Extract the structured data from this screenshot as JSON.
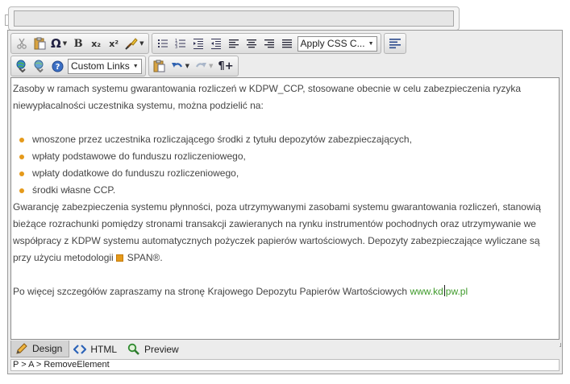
{
  "title_input": {
    "value": ""
  },
  "toolbar": {
    "apply_css_label": "Apply CSS C...",
    "custom_links_label": "Custom Links",
    "bold_label": "B",
    "subscript_label": "x₂",
    "superscript_label": "x²",
    "symbol_label": "Ω",
    "paragraph_label": "¶+"
  },
  "content": {
    "intro": "Zasoby w ramach systemu gwarantowania rozliczeń w KDPW_CCP, stosowane obecnie w celu zabezpieczenia ryzyka niewypłacalności uczestnika systemu, można podzielić na:",
    "items": [
      "wnoszone przez uczestnika rozliczającego środki z tytułu depozytów zabezpieczających,",
      "wpłaty podstawowe do funduszu rozliczeniowego,",
      "wpłaty dodatkowe do funduszu rozliczeniowego,",
      "środki własne CCP."
    ],
    "paragraph2": " Gwarancję zabezpieczenia systemu płynności, poza utrzymywanymi zasobami systemu gwarantowania rozliczeń, stanowią bieżące rozrachunki pomiędzy stronami transakcji zawieranych na rynku instrumentów pochodnych oraz utrzymywanie we współpracy z KDPW systemu automatycznych pożyczek papierów wartościowych. Depozyty zabezpieczające wyliczane są przy użyciu metodologii",
    "span_label": "SPAN®.",
    "paragraph3": "Po więcej szczegółów zapraszamy na stronę Krajowego Depozytu Papierów Wartościowych",
    "link_before_caret": "www.kd",
    "link_after_caret": "pw.pl"
  },
  "modes": {
    "design": "Design",
    "html": "HTML",
    "preview": "Preview"
  },
  "status": {
    "path": "P > A > RemoveElement"
  },
  "colors": {
    "bullet": "#e59a1b",
    "link": "#3e9a2a",
    "toolbar_bg": "#ececec"
  }
}
